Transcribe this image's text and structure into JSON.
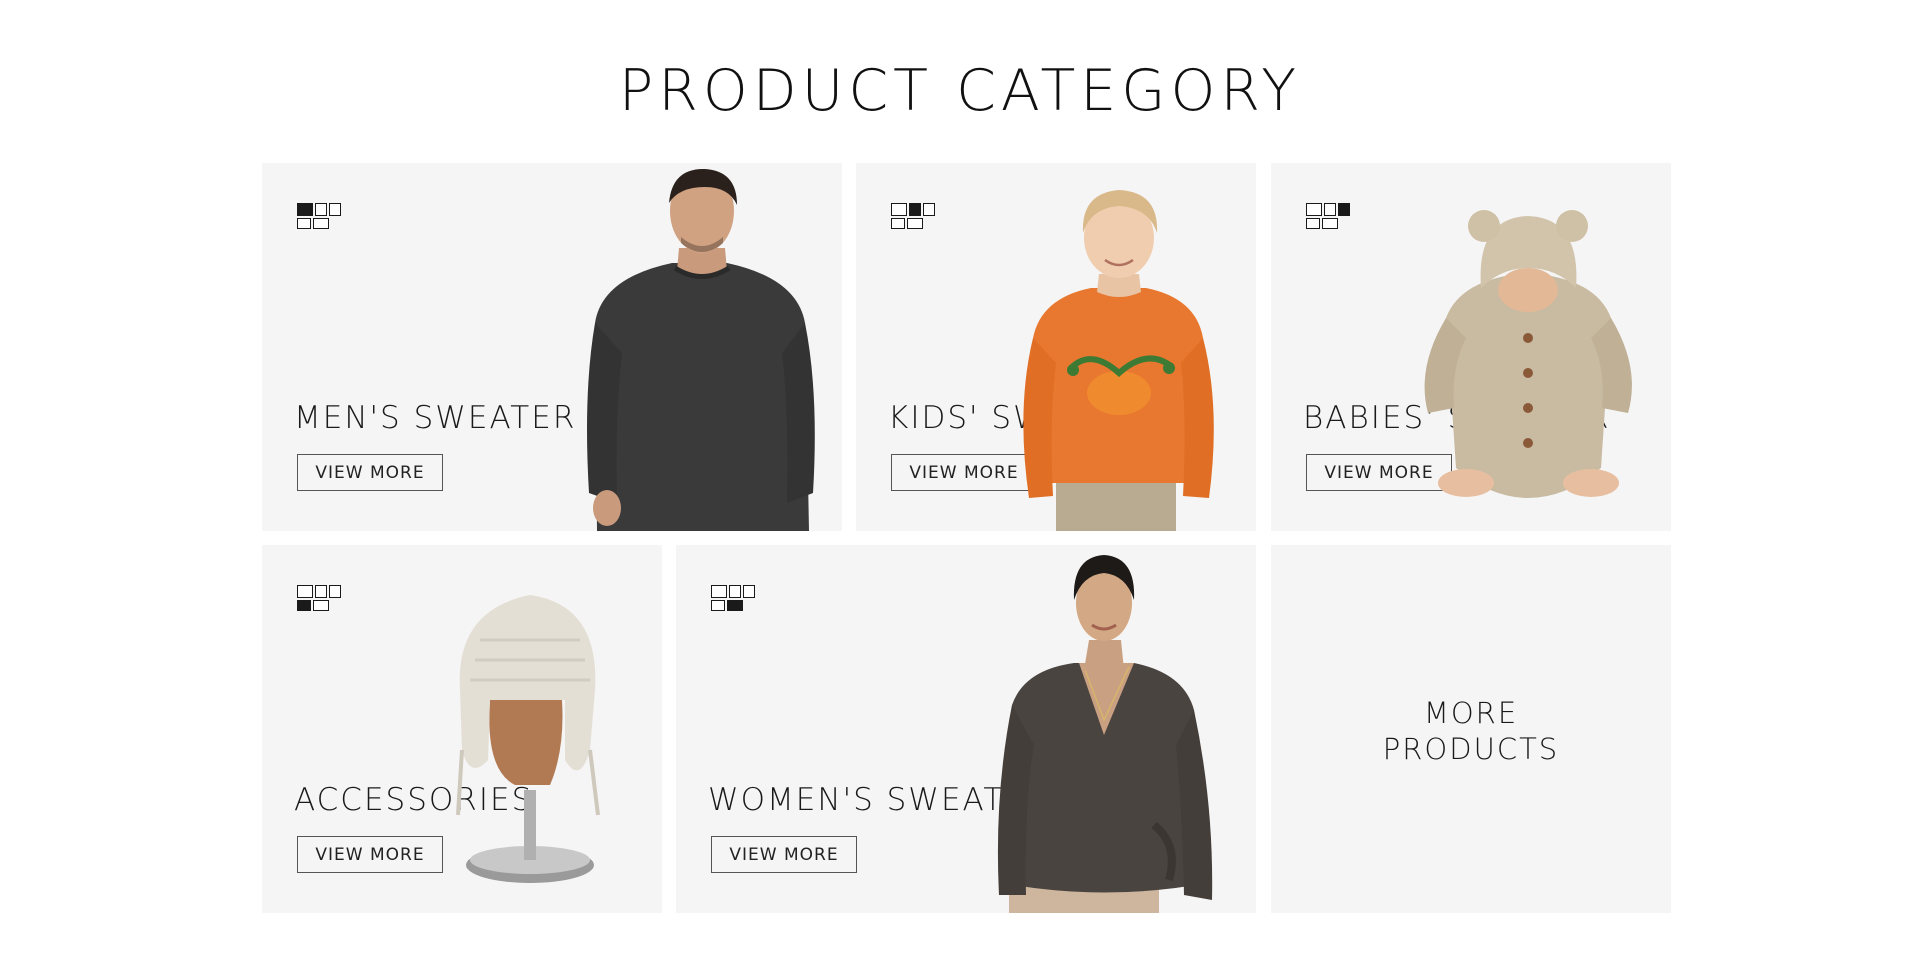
{
  "page": {
    "title": "PRODUCT CATEGORY"
  },
  "categories": [
    {
      "label": "MEN'S SWEATER",
      "button": "VIEW MORE",
      "pattern": [
        1,
        0,
        0,
        0,
        0
      ],
      "image": "man-dark-sweater"
    },
    {
      "label": "KIDS' SWEATER",
      "button": "VIEW MORE",
      "pattern": [
        0,
        1,
        0,
        0,
        0
      ],
      "image": "boy-orange-pumpkin-sweater"
    },
    {
      "label": "BABIES' SWEATER",
      "button": "VIEW MORE",
      "pattern": [
        0,
        0,
        1,
        0,
        0
      ],
      "image": "baby-knit-hoodie"
    },
    {
      "label": "ACCESSORIES",
      "button": "VIEW MORE",
      "pattern": [
        0,
        0,
        0,
        1,
        0
      ],
      "image": "knit-hat-on-mannequin"
    },
    {
      "label": "WOMEN'S SWEATER",
      "button": "VIEW MORE",
      "pattern": [
        0,
        0,
        0,
        0,
        1
      ],
      "image": "woman-wrap-sweater"
    }
  ],
  "more": {
    "line1": "MORE",
    "line2": "PRODUCTS"
  },
  "colors": {
    "card_bg": "#f5f5f5",
    "text": "#1a1a1a",
    "orange": "#e8782f",
    "charcoal": "#3a3a3a"
  }
}
